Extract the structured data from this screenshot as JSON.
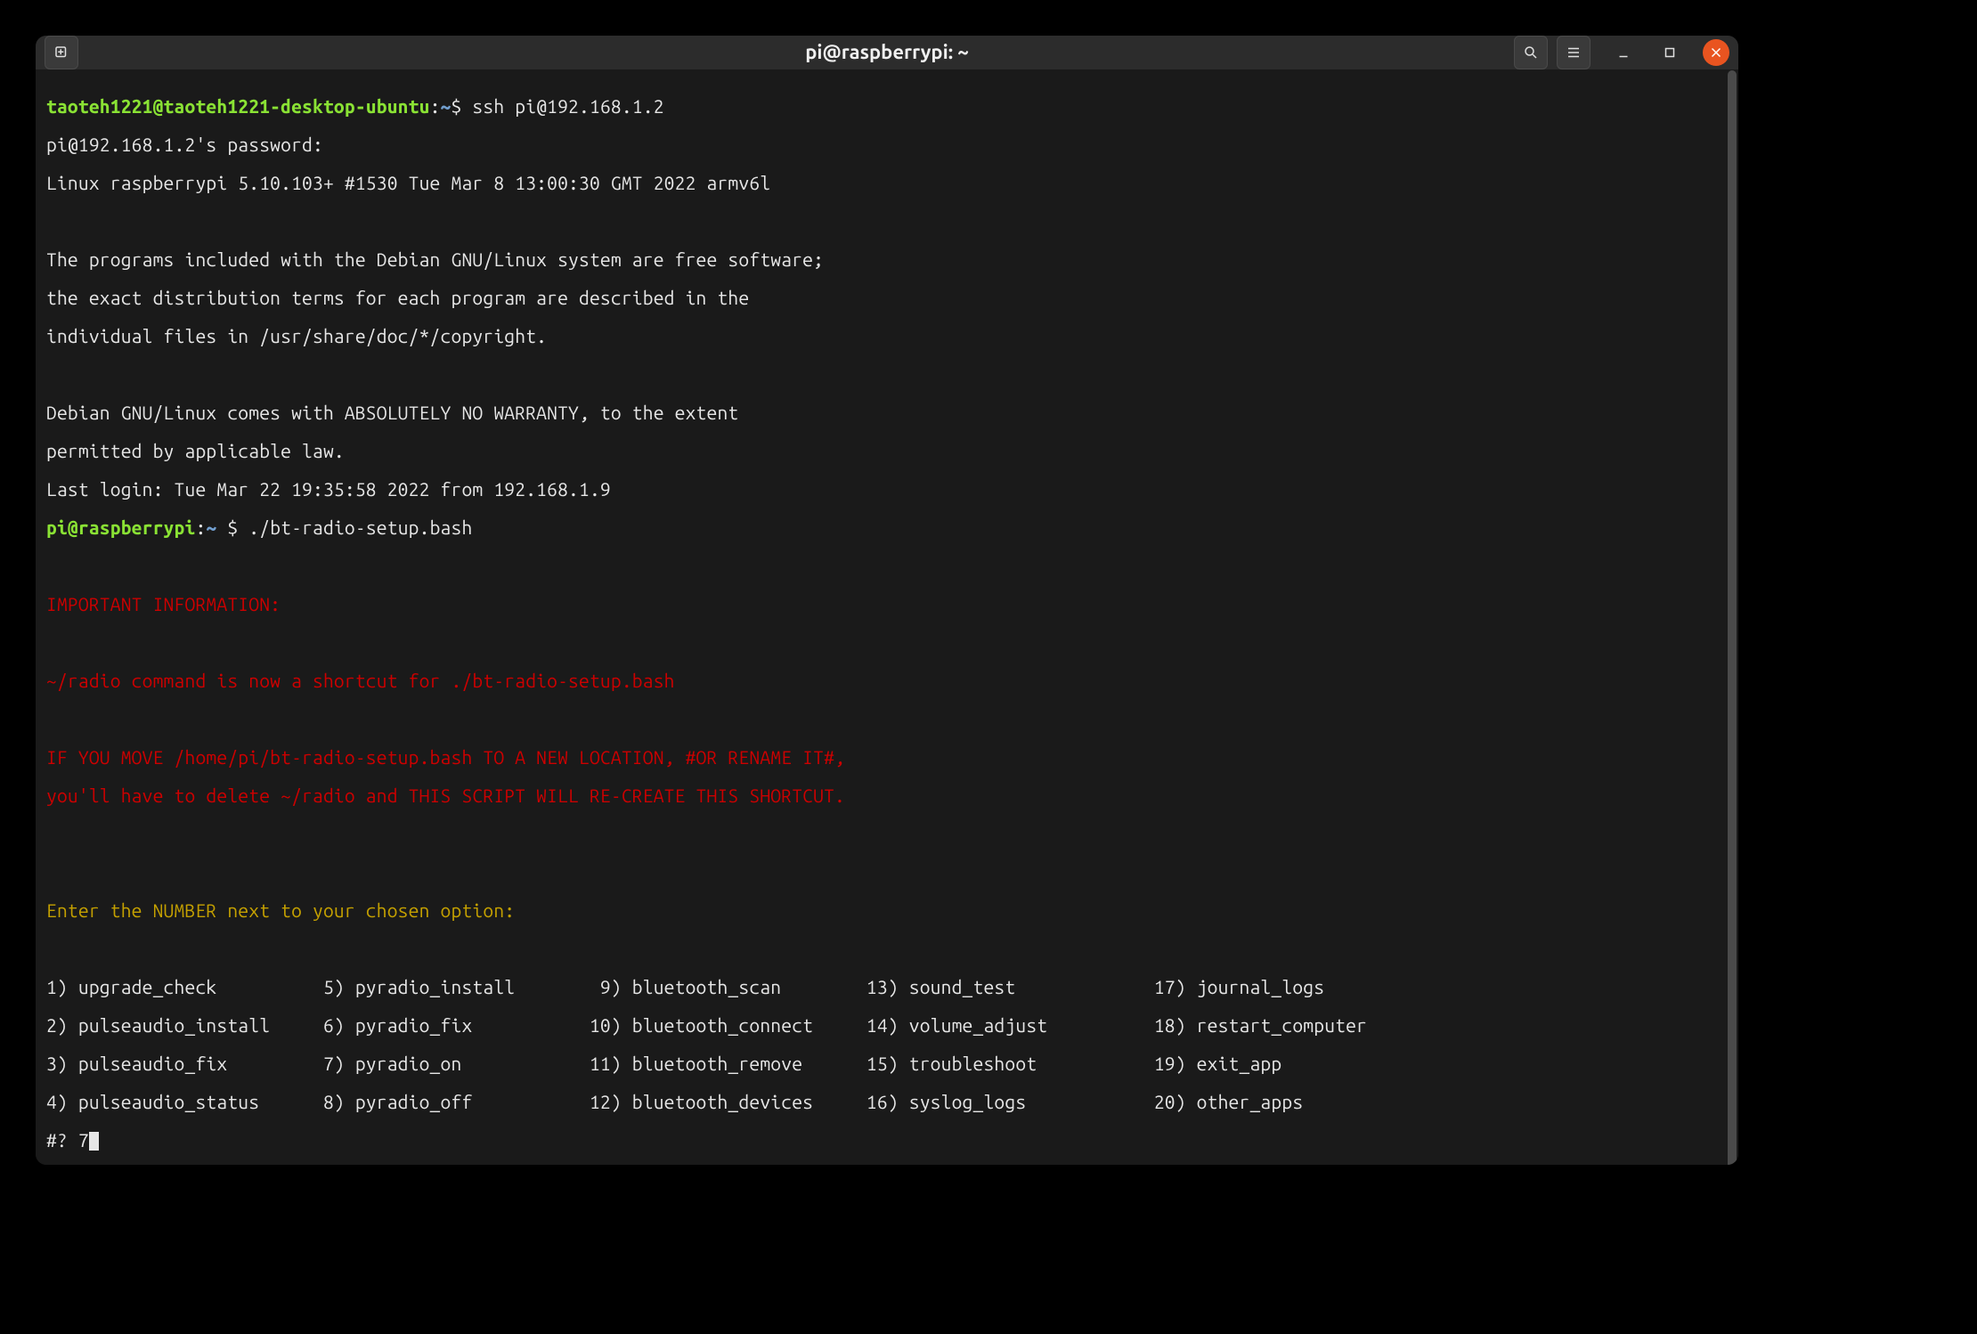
{
  "titlebar": {
    "title": "pi@raspberrypi: ~"
  },
  "terminal": {
    "local_prompt": {
      "user": "taoteh1221@taoteh1221-desktop-ubuntu",
      "path": "~"
    },
    "ssh_command": "ssh pi@192.168.1.2",
    "password_prompt": "pi@192.168.1.2's password:",
    "kernel_line": "Linux raspberrypi 5.10.103+ #1530 Tue Mar 8 13:00:30 GMT 2022 armv6l",
    "motd": [
      "The programs included with the Debian GNU/Linux system are free software;",
      "the exact distribution terms for each program are described in the",
      "individual files in /usr/share/doc/*/copyright.",
      "Debian GNU/Linux comes with ABSOLUTELY NO WARRANTY, to the extent",
      "permitted by applicable law."
    ],
    "last_login": "Last login: Tue Mar 22 19:35:58 2022 from 192.168.1.9",
    "remote_prompt": {
      "user": "pi@raspberrypi",
      "path": "~"
    },
    "script_command": "./bt-radio-setup.bash",
    "info": {
      "heading": "IMPORTANT INFORMATION:",
      "lines": [
        "~/radio command is now a shortcut for ./bt-radio-setup.bash",
        "IF YOU MOVE /home/pi/bt-radio-setup.bash TO A NEW LOCATION, #OR RENAME IT#,",
        "you'll have to delete ~/radio and THIS SCRIPT WILL RE-CREATE THIS SHORTCUT."
      ]
    },
    "menu": {
      "prompt": "Enter the NUMBER next to your chosen option:",
      "options": [
        {
          "n": 1,
          "label": "upgrade_check"
        },
        {
          "n": 2,
          "label": "pulseaudio_install"
        },
        {
          "n": 3,
          "label": "pulseaudio_fix"
        },
        {
          "n": 4,
          "label": "pulseaudio_status"
        },
        {
          "n": 5,
          "label": "pyradio_install"
        },
        {
          "n": 6,
          "label": "pyradio_fix"
        },
        {
          "n": 7,
          "label": "pyradio_on"
        },
        {
          "n": 8,
          "label": "pyradio_off"
        },
        {
          "n": 9,
          "label": "bluetooth_scan"
        },
        {
          "n": 10,
          "label": "bluetooth_connect"
        },
        {
          "n": 11,
          "label": "bluetooth_remove"
        },
        {
          "n": 12,
          "label": "bluetooth_devices"
        },
        {
          "n": 13,
          "label": "sound_test"
        },
        {
          "n": 14,
          "label": "volume_adjust"
        },
        {
          "n": 15,
          "label": "troubleshoot"
        },
        {
          "n": 16,
          "label": "syslog_logs"
        },
        {
          "n": 17,
          "label": "journal_logs"
        },
        {
          "n": 18,
          "label": "restart_computer"
        },
        {
          "n": 19,
          "label": "exit_app"
        },
        {
          "n": 20,
          "label": "other_apps"
        }
      ],
      "rows": [
        "1) upgrade_check          5) pyradio_install        9) bluetooth_scan        13) sound_test             17) journal_logs",
        "2) pulseaudio_install     6) pyradio_fix           10) bluetooth_connect     14) volume_adjust          18) restart_computer",
        "3) pulseaudio_fix         7) pyradio_on            11) bluetooth_remove      15) troubleshoot           19) exit_app",
        "4) pulseaudio_status      8) pyradio_off           12) bluetooth_devices     16) syslog_logs            20) other_apps"
      ]
    },
    "input_prompt": "#? ",
    "input_value": "7"
  },
  "colors": {
    "prompt_green": "#8ae234",
    "path_blue": "#729fcf",
    "warn_red": "#cc0000",
    "menu_yellow": "#c4a000",
    "text": "#e6e6e6",
    "bg": "#1a1a1a",
    "close_button": "#e95420"
  }
}
